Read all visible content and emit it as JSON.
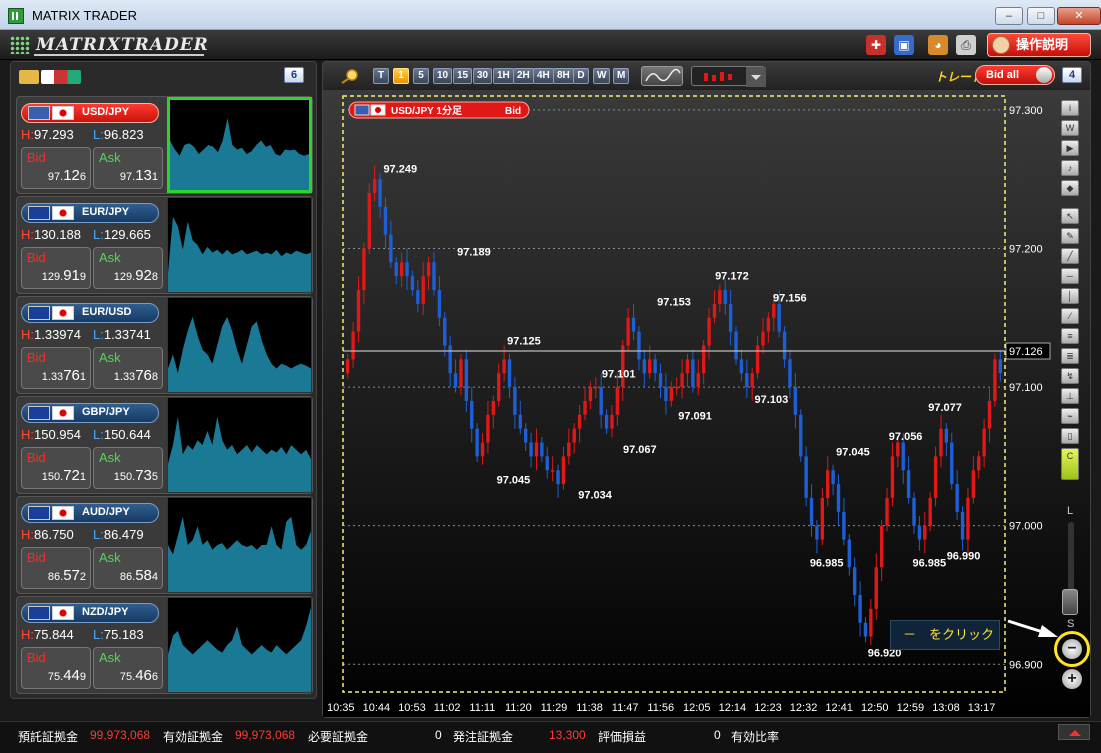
{
  "window": {
    "title": "MATRIX TRADER",
    "minimize": "–",
    "maximize": "□",
    "close": "✕"
  },
  "toolbar": {
    "logo_text": "MATRIXTRADER",
    "help_label": "操作説明"
  },
  "left_panel": {
    "count": "6"
  },
  "pairs": [
    {
      "name": "USD/JPY",
      "high_label": "H:",
      "high": "97.293",
      "low_label": "L:",
      "low": "96.823",
      "bid_label": "Bid",
      "bid_small": "97.",
      "bid_big": "12",
      "bid_tail": "6",
      "ask_label": "Ask",
      "ask_small": "97.",
      "ask_big": "13",
      "ask_tail": "1",
      "active": true,
      "flag1": "#3a5fb0",
      "flag2": "#ffffff",
      "spark": [
        0.45,
        0.55,
        0.62,
        0.5,
        0.48,
        0.52,
        0.6,
        0.55,
        0.5,
        0.52,
        0.58,
        0.45,
        0.2,
        0.5,
        0.55,
        0.53,
        0.6,
        0.57,
        0.5,
        0.45,
        0.52,
        0.5,
        0.6,
        0.62,
        0.55,
        0.56,
        0.55,
        0.6,
        0.62,
        0.6
      ]
    },
    {
      "name": "EUR/JPY",
      "high_label": "H:",
      "high": "130.188",
      "low_label": "L:",
      "low": "129.665",
      "bid_label": "Bid",
      "bid_small": "129.",
      "bid_big": "91",
      "bid_tail": "9",
      "ask_label": "Ask",
      "ask_small": "129.",
      "ask_big": "92",
      "ask_tail": "8",
      "active": false,
      "flag1": "#1a3f9a",
      "flag2": "#ffffff",
      "spark": [
        0.8,
        0.2,
        0.3,
        0.55,
        0.25,
        0.45,
        0.5,
        0.6,
        0.52,
        0.58,
        0.55,
        0.6,
        0.55,
        0.6,
        0.58,
        0.55,
        0.6,
        0.58,
        0.56,
        0.6,
        0.58,
        0.6,
        0.55,
        0.62,
        0.58,
        0.6,
        0.56,
        0.58,
        0.6,
        0.58
      ]
    },
    {
      "name": "EUR/USD",
      "high_label": "H:",
      "high": "1.33974",
      "low_label": "L:",
      "low": "1.33741",
      "bid_label": "Bid",
      "bid_small": "1.33",
      "bid_big": "76",
      "bid_tail": "1",
      "ask_label": "Ask",
      "ask_small": "1.33",
      "ask_big": "76",
      "ask_tail": "8",
      "active": false,
      "flag1": "#1a3f9a",
      "flag2": "#3a5fb0",
      "spark": [
        0.75,
        0.6,
        0.8,
        0.55,
        0.35,
        0.2,
        0.4,
        0.55,
        0.6,
        0.7,
        0.5,
        0.3,
        0.2,
        0.35,
        0.55,
        0.7,
        0.5,
        0.3,
        0.25,
        0.45,
        0.6,
        0.7,
        0.75,
        0.7,
        0.72,
        0.75,
        0.72,
        0.7,
        0.72,
        0.75
      ]
    },
    {
      "name": "GBP/JPY",
      "high_label": "H:",
      "high": "150.954",
      "low_label": "L:",
      "low": "150.644",
      "bid_label": "Bid",
      "bid_small": "150.",
      "bid_big": "72",
      "bid_tail": "1",
      "ask_label": "Ask",
      "ask_small": "150.",
      "ask_big": "73",
      "ask_tail": "5",
      "active": false,
      "flag1": "#1a3f9a",
      "flag2": "#ffffff",
      "spark": [
        0.7,
        0.5,
        0.2,
        0.6,
        0.5,
        0.55,
        0.45,
        0.5,
        0.35,
        0.5,
        0.2,
        0.45,
        0.55,
        0.5,
        0.6,
        0.55,
        0.5,
        0.58,
        0.5,
        0.55,
        0.6,
        0.55,
        0.58,
        0.52,
        0.6,
        0.5,
        0.55,
        0.6,
        0.55,
        0.65
      ]
    },
    {
      "name": "AUD/JPY",
      "high_label": "H:",
      "high": "86.750",
      "low_label": "L:",
      "low": "86.479",
      "bid_label": "Bid",
      "bid_small": "86.",
      "bid_big": "57",
      "bid_tail": "2",
      "ask_label": "Ask",
      "ask_small": "86.",
      "ask_big": "58",
      "ask_tail": "4",
      "active": false,
      "flag1": "#1a3f9a",
      "flag2": "#ffffff",
      "spark": [
        0.5,
        0.6,
        0.4,
        0.2,
        0.5,
        0.45,
        0.3,
        0.5,
        0.45,
        0.55,
        0.5,
        0.48,
        0.55,
        0.5,
        0.45,
        0.5,
        0.52,
        0.5,
        0.55,
        0.5,
        0.5,
        0.3,
        0.5,
        0.55,
        0.25,
        0.2,
        0.5,
        0.55,
        0.5,
        0.35
      ]
    },
    {
      "name": "NZD/JPY",
      "high_label": "H:",
      "high": "75.844",
      "low_label": "L:",
      "low": "75.183",
      "bid_label": "Bid",
      "bid_small": "75.",
      "bid_big": "44",
      "bid_tail": "9",
      "ask_label": "Ask",
      "ask_small": "75.",
      "ask_big": "46",
      "ask_tail": "6",
      "active": false,
      "flag1": "#1a3f9a",
      "flag2": "#ffffff",
      "spark": [
        0.6,
        0.4,
        0.35,
        0.5,
        0.55,
        0.6,
        0.55,
        0.5,
        0.45,
        0.5,
        0.55,
        0.58,
        0.5,
        0.45,
        0.3,
        0.5,
        0.55,
        0.6,
        0.55,
        0.5,
        0.55,
        0.58,
        0.5,
        0.55,
        0.6,
        0.55,
        0.5,
        0.45,
        0.3,
        0.1
      ]
    }
  ],
  "chart_toolbar": {
    "timeframes": [
      "T",
      "1",
      "5",
      "10",
      "15",
      "30",
      "1H",
      "2H",
      "4H",
      "8H",
      "D",
      "W",
      "M"
    ],
    "selected": "1",
    "trade_label": "トレード",
    "bid_all_label": "Bid all",
    "count": "4"
  },
  "chart_header": {
    "pair": "USD/JPY 1分足",
    "side": "Bid"
  },
  "chart_data": {
    "type": "candlestick",
    "x_labels": [
      "10:35",
      "10:44",
      "10:53",
      "11:02",
      "11:11",
      "11:20",
      "11:29",
      "11:38",
      "11:47",
      "11:56",
      "12:05",
      "12:14",
      "12:23",
      "12:32",
      "12:41",
      "12:50",
      "12:59",
      "13:08",
      "13:17"
    ],
    "y_ticks": [
      "97.300",
      "97.200",
      "97.100",
      "97.000",
      "96.900"
    ],
    "y_range": [
      96.88,
      97.31
    ],
    "current_price": "97.126",
    "current_value": 97.126,
    "annotations": [
      {
        "text": "97.249",
        "xi": 2.1,
        "y": 97.249,
        "pos": "above"
      },
      {
        "text": "97.189",
        "xi": 4.9,
        "y": 97.189,
        "pos": "above"
      },
      {
        "text": "97.125",
        "xi": 6.8,
        "y": 97.125,
        "pos": "above"
      },
      {
        "text": "97.045",
        "xi": 6.4,
        "y": 97.045,
        "pos": "below"
      },
      {
        "text": "97.034",
        "xi": 9.5,
        "y": 97.034,
        "pos": "below"
      },
      {
        "text": "97.101",
        "xi": 10.4,
        "y": 97.101,
        "pos": "above"
      },
      {
        "text": "97.067",
        "xi": 11.2,
        "y": 97.067,
        "pos": "below"
      },
      {
        "text": "97.153",
        "xi": 12.5,
        "y": 97.153,
        "pos": "above"
      },
      {
        "text": "97.091",
        "xi": 13.3,
        "y": 97.091,
        "pos": "below"
      },
      {
        "text": "97.172",
        "xi": 14.7,
        "y": 97.172,
        "pos": "above"
      },
      {
        "text": "97.103",
        "xi": 16.2,
        "y": 97.103,
        "pos": "below"
      },
      {
        "text": "97.156",
        "xi": 16.9,
        "y": 97.156,
        "pos": "above"
      },
      {
        "text": "97.045",
        "xi": 19.3,
        "y": 97.045,
        "pos": "above"
      },
      {
        "text": "96.985",
        "xi": 18.3,
        "y": 96.985,
        "pos": "below"
      },
      {
        "text": "96.920",
        "xi": 20.5,
        "y": 96.92,
        "pos": "below"
      },
      {
        "text": "97.056",
        "xi": 21.3,
        "y": 97.056,
        "pos": "above"
      },
      {
        "text": "96.985",
        "xi": 22.2,
        "y": 96.985,
        "pos": "below"
      },
      {
        "text": "97.077",
        "xi": 22.8,
        "y": 97.077,
        "pos": "above"
      },
      {
        "text": "96.990",
        "xi": 23.5,
        "y": 96.99,
        "pos": "below"
      }
    ],
    "path": [
      97.12,
      97.14,
      97.17,
      97.2,
      97.24,
      97.25,
      97.23,
      97.21,
      97.19,
      97.18,
      97.19,
      97.18,
      97.17,
      97.16,
      97.18,
      97.19,
      97.17,
      97.15,
      97.13,
      97.11,
      97.1,
      97.12,
      97.09,
      97.07,
      97.05,
      97.06,
      97.08,
      97.09,
      97.11,
      97.12,
      97.1,
      97.08,
      97.07,
      97.06,
      97.05,
      97.06,
      97.05,
      97.04,
      97.04,
      97.03,
      97.05,
      97.06,
      97.07,
      97.08,
      97.09,
      97.1,
      97.1,
      97.08,
      97.07,
      97.08,
      97.1,
      97.13,
      97.15,
      97.14,
      97.12,
      97.11,
      97.12,
      97.11,
      97.1,
      97.09,
      97.1,
      97.1,
      97.11,
      97.12,
      97.1,
      97.11,
      97.13,
      97.15,
      97.16,
      97.17,
      97.16,
      97.14,
      97.12,
      97.11,
      97.1,
      97.11,
      97.13,
      97.14,
      97.15,
      97.16,
      97.14,
      97.12,
      97.1,
      97.08,
      97.05,
      97.02,
      97.0,
      96.99,
      97.02,
      97.04,
      97.03,
      97.01,
      96.99,
      96.97,
      96.95,
      96.93,
      96.92,
      96.94,
      96.97,
      97.0,
      97.02,
      97.05,
      97.06,
      97.04,
      97.02,
      97.0,
      96.99,
      97.0,
      97.02,
      97.05,
      97.07,
      97.06,
      97.03,
      97.01,
      96.99,
      97.02,
      97.04,
      97.05,
      97.07,
      97.09,
      97.12,
      97.11
    ]
  },
  "chart_side": {
    "l_label": "L",
    "s_label": "S"
  },
  "hint": {
    "text": "－　をクリック"
  },
  "status": {
    "deposit_label": "預託証拠金",
    "deposit_value": "99,973,068",
    "valid_label": "有効証拠金",
    "valid_value": "99,973,068",
    "required_label": "必要証拠金",
    "required_value": "0",
    "order_label": "発注証拠金",
    "order_value": "13,300",
    "pl_label": "評価損益",
    "pl_value": "0",
    "ratio_label": "有効比率"
  },
  "colors": {
    "up": "#e01818",
    "down": "#1e5fd6",
    "accent": "#ffe422"
  }
}
